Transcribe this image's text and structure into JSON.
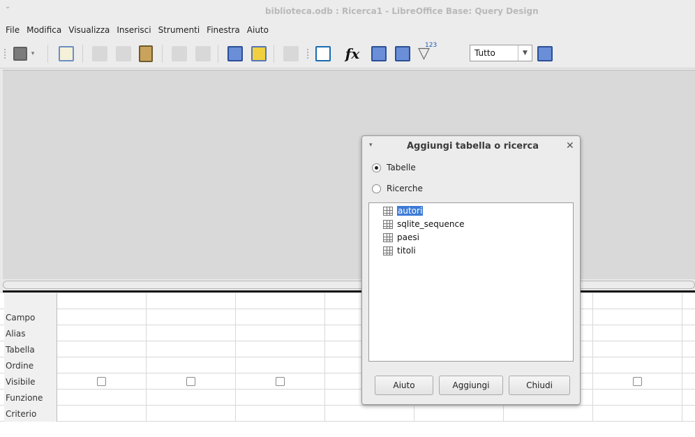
{
  "window": {
    "title": "biblioteca.odb : Ricerca1 - LibreOffice Base: Query Design",
    "menu_glyph": "⌄"
  },
  "menubar": [
    "File",
    "Modifica",
    "Visualizza",
    "Inserisci",
    "Strumenti",
    "Finestra",
    "Aiuto"
  ],
  "toolbar": {
    "combo_value": "Tutto",
    "funnel_badge": "123",
    "fx_label": "fx"
  },
  "grid": {
    "row_labels": [
      "Campo",
      "Alias",
      "Tabella",
      "Ordine",
      "Visibile",
      "Funzione",
      "Criterio"
    ]
  },
  "dialog": {
    "title": "Aggiungi tabella o ricerca",
    "close_glyph": "✕",
    "menu_glyph": "▾",
    "radio_tables": "Tabelle",
    "radio_queries": "Ricerche",
    "selected_radio": "Tabelle",
    "items": [
      "autori",
      "sqlite_sequence",
      "paesi",
      "titoli"
    ],
    "selected_item": "autori",
    "buttons": {
      "help": "Aiuto",
      "add": "Aggiungi",
      "close": "Chiudi"
    }
  },
  "colors": {
    "selection": "#3d7bd6",
    "design_bg": "#d9d9d9"
  }
}
